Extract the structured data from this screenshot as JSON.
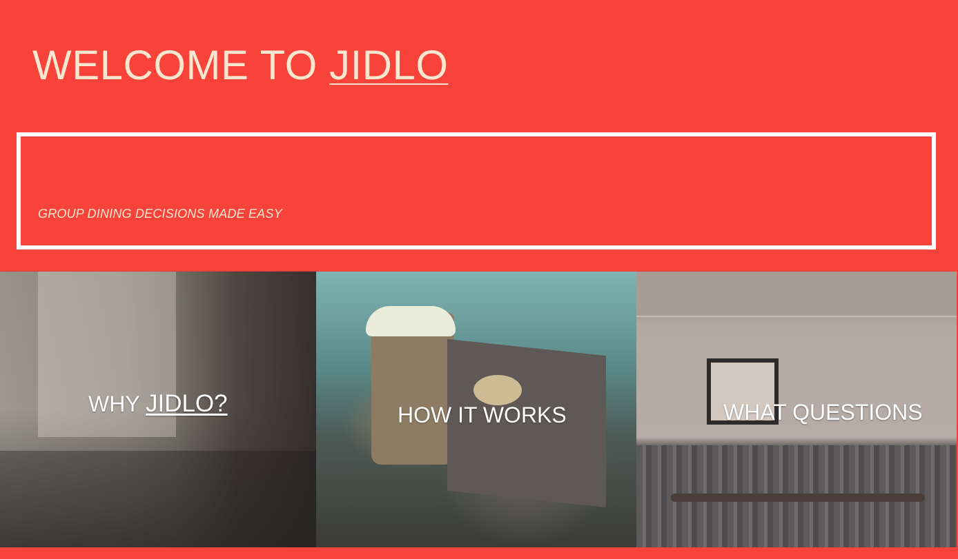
{
  "hero": {
    "prefix": "WELCOME TO ",
    "brand": "JIDLO"
  },
  "tagline": "GROUP DINING DECISIONS MADE EASY",
  "panels": [
    {
      "prefix": "WHY ",
      "link": "JIDLO?"
    },
    {
      "label": "HOW IT WORKS"
    },
    {
      "label": "WHAT QUESTIONS"
    }
  ],
  "colors": {
    "background": "#f8433a",
    "heading_text": "#fbe6cf",
    "border": "#ffffff"
  }
}
